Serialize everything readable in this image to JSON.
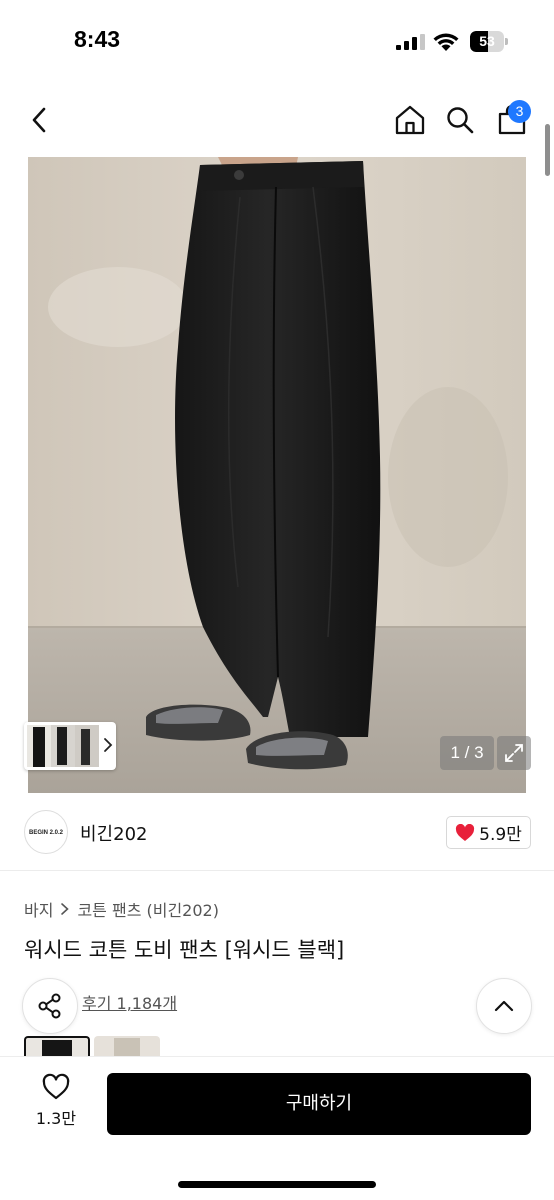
{
  "status_bar": {
    "time": "8:43",
    "battery_percent": "53",
    "battery_level": 0.53,
    "icons": [
      "cellular-signal-icon",
      "wifi-icon",
      "battery-icon"
    ]
  },
  "nav": {
    "icons": [
      "back-chevron-icon",
      "home-icon",
      "search-icon",
      "shopping-bag-icon"
    ],
    "cart_badge": "3",
    "badge_color": "#1f78ff"
  },
  "gallery": {
    "counter": "1 / 3",
    "current_index": 1,
    "total": 3
  },
  "brand": {
    "logo_text": "BEGIN 2.0.2",
    "name": "비긴202",
    "like_count": "5.9만",
    "heart_color": "#e8203a"
  },
  "product": {
    "breadcrumb": [
      "바지",
      "코튼 팬츠 (비긴202)"
    ],
    "title": "워시드 코튼 도비 팬츠 [워시드 블랙]",
    "review_link": "후기 1,184개"
  },
  "bottom_bar": {
    "favorite_count": "1.3만",
    "buy_label": "구매하기"
  }
}
